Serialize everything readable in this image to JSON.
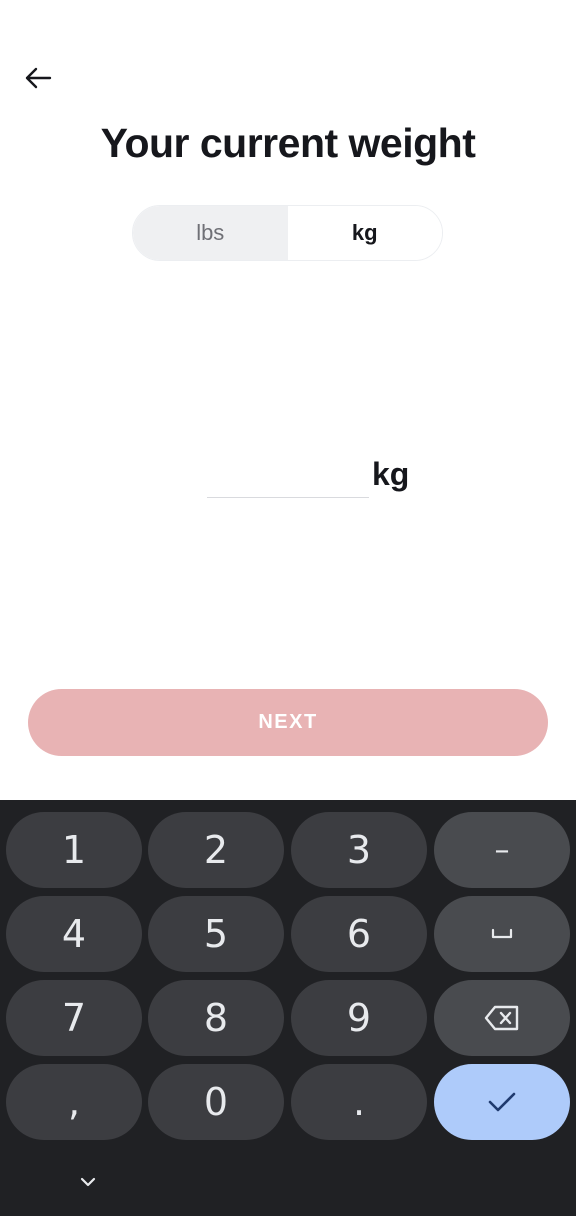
{
  "header": {
    "back_icon": "arrow-left-icon",
    "title": "Your current weight"
  },
  "unit_toggle": {
    "options": [
      "lbs",
      "kg"
    ],
    "selected": "kg"
  },
  "weight_field": {
    "value": "",
    "placeholder": "",
    "unit": "kg"
  },
  "next_button": {
    "label": "NEXT"
  },
  "keyboard": {
    "keys": {
      "one": "1",
      "two": "2",
      "three": "3",
      "dash": "–",
      "four": "4",
      "five": "5",
      "six": "6",
      "seven": "7",
      "eight": "8",
      "nine": "9",
      "comma": ",",
      "zero": "0",
      "period": "."
    },
    "space_icon": "space-bar-icon",
    "backspace_icon": "backspace-icon",
    "enter_icon": "checkmark-icon",
    "collapse_icon": "chevron-down-icon"
  },
  "colors": {
    "next_button_bg": "#e8b3b4",
    "keyboard_bg": "#202124",
    "key_bg": "#3c3d41",
    "enter_key_bg": "#aecbfa"
  }
}
